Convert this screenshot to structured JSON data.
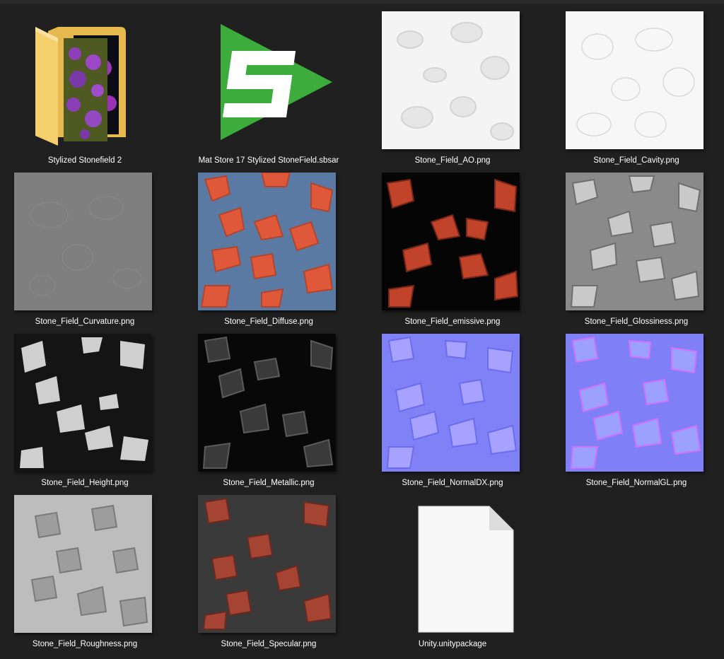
{
  "window": {
    "view": "large-icons"
  },
  "files": [
    {
      "name": "Stylized Stonefield 2",
      "kind": "folder",
      "icon": "folder-icon"
    },
    {
      "name": "Mat Store 17 Stylized StoneField.sbsar",
      "kind": "sbsar",
      "icon": "substance-logo-icon",
      "accent": "#3cad3c"
    },
    {
      "name": "Stone_Field_AO.png",
      "kind": "image",
      "preview": "ao"
    },
    {
      "name": "Stone_Field_Cavity.png",
      "kind": "image",
      "preview": "cavity"
    },
    {
      "name": "Stone_Field_Curvature.png",
      "kind": "image",
      "preview": "curvature"
    },
    {
      "name": "Stone_Field_Diffuse.png",
      "kind": "image",
      "preview": "diffuse"
    },
    {
      "name": "Stone_Field_emissive.png",
      "kind": "image",
      "preview": "emissive"
    },
    {
      "name": "Stone_Field_Glossiness.png",
      "kind": "image",
      "preview": "glossiness"
    },
    {
      "name": "Stone_Field_Height.png",
      "kind": "image",
      "preview": "height"
    },
    {
      "name": "Stone_Field_Metallic.png",
      "kind": "image",
      "preview": "metallic"
    },
    {
      "name": "Stone_Field_NormalDX.png",
      "kind": "image",
      "preview": "normaldx"
    },
    {
      "name": "Stone_Field_NormalGL.png",
      "kind": "image",
      "preview": "normalgl"
    },
    {
      "name": "Stone_Field_Roughness.png",
      "kind": "image",
      "preview": "roughness"
    },
    {
      "name": "Stone_Field_Specular.png",
      "kind": "image",
      "preview": "specular"
    },
    {
      "name": "Unity.unitypackage",
      "kind": "file",
      "icon": "blank-file-icon"
    }
  ],
  "colors": {
    "background": "#202020",
    "label": "#ffffff",
    "folder": "#f5cf6b",
    "sbsar_green": "#3cad3c"
  }
}
